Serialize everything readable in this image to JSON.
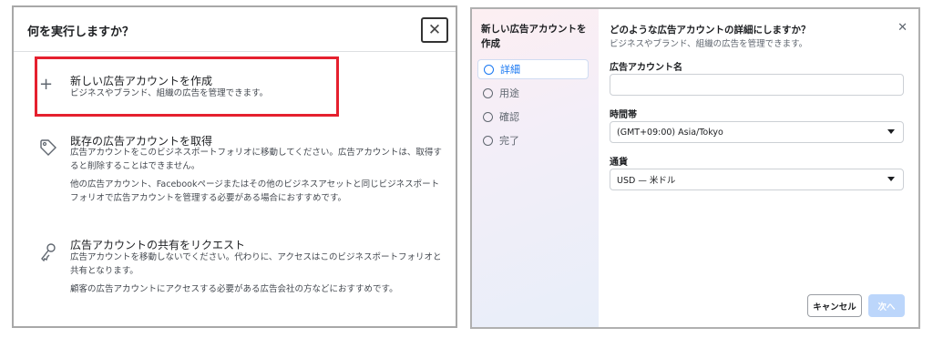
{
  "left_dialog": {
    "title": "何を実行しますか？",
    "close": "✕",
    "options": [
      {
        "icon": "plus-icon",
        "title": "新しい広告アカウントを作成",
        "desc": "ビジネスやブランド、組織の広告を管理できます。"
      },
      {
        "icon": "tag-icon",
        "title": "既存の広告アカウントを取得",
        "desc": "広告アカウントをこのビジネスポートフォリオに移動してください。広告アカウントは、取得すると削除することはできません。",
        "desc2": "他の広告アカウント、Facebookページまたはその他のビジネスアセットと同じビジネスポートフォリオで広告アカウントを管理する必要がある場合におすすめです。"
      },
      {
        "icon": "key-icon",
        "title": "広告アカウントの共有をリクエスト",
        "desc": "広告アカウントを移動しないでください。代わりに、アクセスはこのビジネスポートフォリオと共有となります。",
        "desc2": "顧客の広告アカウントにアクセスする必要がある広告会社の方などにおすすめです。"
      }
    ],
    "highlight_color": "#e5202e"
  },
  "right_dialog": {
    "side_title": "新しい広告アカウントを作成",
    "steps": [
      {
        "label": "詳細",
        "active": true
      },
      {
        "label": "用途",
        "active": false
      },
      {
        "label": "確認",
        "active": false
      },
      {
        "label": "完了",
        "active": false
      }
    ],
    "title": "どのような広告アカウントの詳細にしますか？",
    "subtitle": "ビジネスやブランド、組織の広告を管理できます。",
    "close": "✕",
    "fields": {
      "account_name": {
        "label": "広告アカウント名",
        "value": ""
      },
      "timezone": {
        "label": "時間帯",
        "value": "(GMT+09:00) Asia/Tokyo"
      },
      "currency": {
        "label": "通貨",
        "value": "USD — 米ドル"
      }
    },
    "cancel": "キャンセル",
    "next": "次へ",
    "accent": "#1877f2"
  }
}
